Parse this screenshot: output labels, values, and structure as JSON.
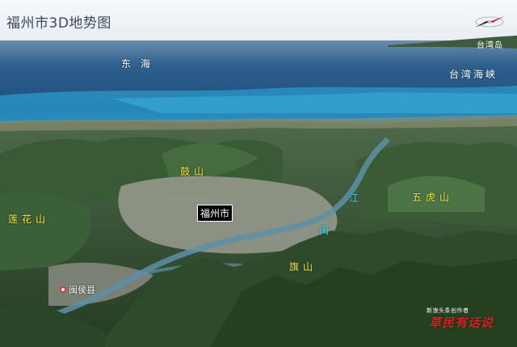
{
  "title": "福州市3D地势图",
  "compass": {
    "icon": "compass-icon"
  },
  "labels": {
    "east_sea": "东 海",
    "taiwan_strait": "台湾海峡",
    "taiwan_island": "台湾岛",
    "gu_shan": "鼓山",
    "wuhu_shan": "五虎山",
    "lianhua_shan": "莲花山",
    "qi_shan": "旗山",
    "min_river_jiang": "江",
    "min_river_min": "闽",
    "fuzhou_city": "福州市",
    "minhou_county": "闽侯县"
  },
  "watermark": {
    "subtitle": "新浪头条创作者",
    "author": "草民有话说"
  },
  "colors": {
    "sky": "#f2f5f8",
    "sea_deep": "#1f4f80",
    "sea_shallow": "#2b9ac8",
    "mountain": "#2e4a2c",
    "urban": "#9a9c90",
    "mountain_label": "#f6e84a",
    "river_label": "#3ad7e8",
    "watermark": "#d22424"
  }
}
